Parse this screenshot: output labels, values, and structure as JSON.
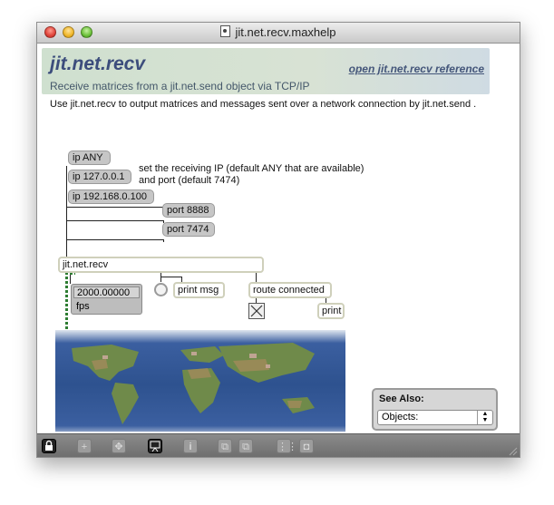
{
  "window": {
    "title": "jit.net.recv.maxhelp"
  },
  "header": {
    "title": "jit.net.recv",
    "subtitle": "Receive matrices from a jit.net.send object via TCP/IP",
    "reference_link": "open jit.net.recv reference"
  },
  "description": "Use jit.net.recv to output matrices and messages sent over a network connection by jit.net.send .",
  "messages": {
    "ip_any": "ip ANY",
    "ip_local": "ip 127.0.0.1",
    "ip_lan": "ip 192.168.0.100",
    "port_8888": "port 8888",
    "port_7474": "port 7474"
  },
  "comment": {
    "line1": "set the receiving IP (default ANY that are available)",
    "line2": "and port (default 7474)"
  },
  "objects": {
    "recv": "jit.net.recv",
    "print_msg": "print msg",
    "route": "route connected",
    "print": "print"
  },
  "fps_box": {
    "value": "2000.00000",
    "unit": "fps"
  },
  "see_also": {
    "label": "See Also:",
    "selected": "Objects:"
  },
  "toolbar": {
    "icons": [
      "lock-icon",
      "add-icon",
      "move-icon",
      "presentation-icon",
      "inspector-icon",
      "copy-icon",
      "paste-icon",
      "grid-icon",
      "snap-icon"
    ]
  },
  "colors": {
    "title_blue": "#3c4d7c",
    "object_border": "#cfd0bb",
    "message_bg": "#c6c6c6",
    "patch_cord_matrix": "#2e7d32"
  }
}
